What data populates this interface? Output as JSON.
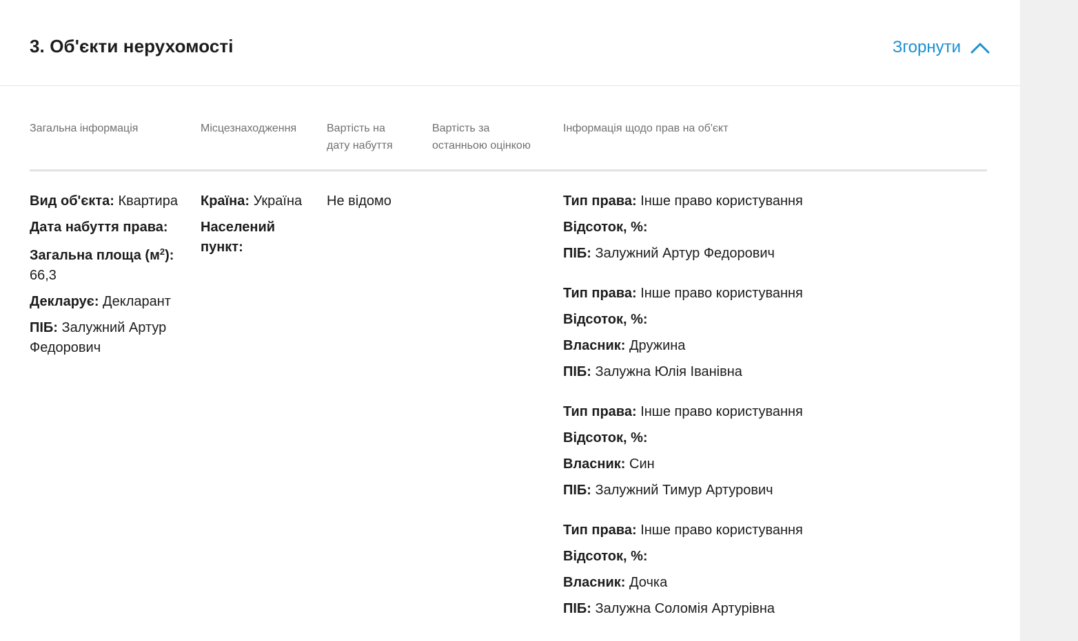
{
  "section": {
    "title": "3. Об'єкти нерухомості",
    "collapse_label": "Згорнути"
  },
  "columns": {
    "general": "Загальна інформація",
    "location": "Місцезнаходження",
    "cost_acquisition": "Вартість на дату набуття",
    "cost_last_valuation": "Вартість за останньою оцінкою",
    "rights_info": "Інформація щодо прав на об'єкт"
  },
  "object": {
    "type_label": "Вид об'єкта:",
    "type_value": "Квартира",
    "acq_date_label": "Дата набуття права:",
    "area_label_prefix": "Загальна площа (м",
    "area_label_sup": "2",
    "area_label_suffix": "):",
    "area_value": "66,3",
    "declares_label": "Декларує:",
    "declares_value": "Декларант",
    "pib_label": "ПІБ:",
    "pib_value": "Залужний Артур Федорович"
  },
  "location": {
    "country_label": "Країна:",
    "country_value": "Україна",
    "settlement_label": "Населений пункт:"
  },
  "cost": {
    "acquisition_value": "Не відомо"
  },
  "rights": [
    {
      "type_label": "Тип права:",
      "type_value": "Інше право користування",
      "percent_label": "Відсоток, %:",
      "pib_label": "ПІБ:",
      "pib_value": "Залужний Артур Федорович"
    },
    {
      "type_label": "Тип права:",
      "type_value": "Інше право користування",
      "percent_label": "Відсоток, %:",
      "owner_label": "Власник:",
      "owner_value": "Дружина",
      "pib_label": "ПІБ:",
      "pib_value": "Залужна Юлія Іванівна"
    },
    {
      "type_label": "Тип права:",
      "type_value": "Інше право користування",
      "percent_label": "Відсоток, %:",
      "owner_label": "Власник:",
      "owner_value": "Син",
      "pib_label": "ПІБ:",
      "pib_value": "Залужний Тимур Артурович"
    },
    {
      "type_label": "Тип права:",
      "type_value": "Інше право користування",
      "percent_label": "Відсоток, %:",
      "owner_label": "Власник:",
      "owner_value": "Дочка",
      "pib_label": "ПІБ:",
      "pib_value": "Залужна Соломія Артурівна"
    }
  ],
  "icons": {
    "collapse": "chevron-up-icon"
  },
  "colors": {
    "accent": "#1a90d2",
    "text": "#1c1c1c",
    "muted": "#707070",
    "divider": "#e2e2e2",
    "sidebar_bg": "#f0f0f0"
  }
}
